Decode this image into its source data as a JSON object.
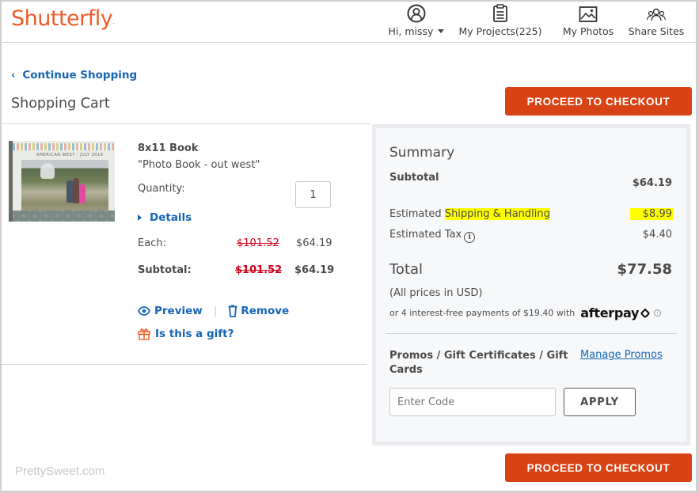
{
  "header": {
    "logo": "Shutterfly",
    "logo_mark": ".",
    "nav": [
      {
        "label": "Hi, missy",
        "icon": "user-circle-icon",
        "has_dropdown": true
      },
      {
        "label": "My Projects(225)",
        "icon": "clipboard-icon"
      },
      {
        "label": "My Photos",
        "icon": "image-icon"
      },
      {
        "label": "Share Sites",
        "icon": "people-group-icon"
      }
    ]
  },
  "page": {
    "continue_label": "Continue Shopping",
    "continue_icon": "‹",
    "title": "Shopping Cart",
    "checkout_label": "PROCEED TO CHECKOUT"
  },
  "cart_item": {
    "thumbnail_title": "AMERICAN WEST · JULY 2019",
    "name": "8x11 Book",
    "project_name": "\"Photo Book - out west\"",
    "quantity_label": "Quantity:",
    "quantity": "1",
    "details_label": "Details",
    "each_label": "Each:",
    "each_original": "$101.52",
    "each_price": "$64.19",
    "subtotal_label": "Subtotal:",
    "subtotal_original": "$101.52",
    "subtotal_price": "$64.19",
    "preview_label": "Preview",
    "separator": "|",
    "remove_label": "Remove",
    "gift_label": "Is this a gift?"
  },
  "summary": {
    "title": "Summary",
    "subtotal_label": "Subtotal",
    "subtotal_value": "$64.19",
    "shipping_prefix": "Estimated ",
    "shipping_label": "Shipping & Handling",
    "shipping_value": "$8.99",
    "tax_label": "Estimated Tax",
    "tax_info_icon": "i",
    "tax_value": "$4.40",
    "total_label": "Total",
    "total_value": "$77.58",
    "currency_note": "(All prices in USD)",
    "afterpay_text": "or 4 interest-free payments of $19.40 with",
    "afterpay_brand": "afterpay",
    "afterpay_info_icon": "i",
    "promos_label": "Promos / Gift Certificates / Gift Cards",
    "manage_promos_label": "Manage Promos",
    "code_placeholder": "Enter Code",
    "apply_label": "APPLY"
  },
  "watermark": "PrettySweet.com",
  "colors": {
    "brand": "#f05a28",
    "checkout_button": "#d84315",
    "link": "#1565b7",
    "strike_price": "#d0021b",
    "highlight": "#ffff00"
  }
}
